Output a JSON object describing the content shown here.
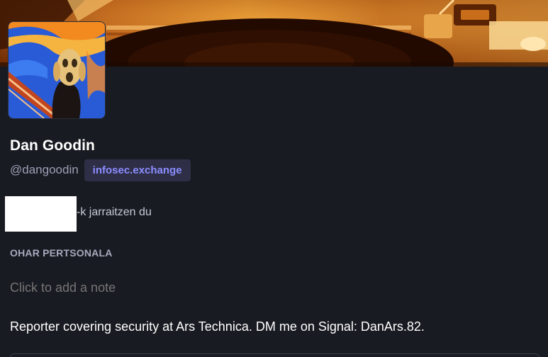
{
  "profile": {
    "display_name": "Dan Goodin",
    "username": "@dangoodin",
    "domain": "infosec.exchange",
    "follows_you_text": "-k jarraitzen du",
    "bio": "Reporter covering security at Ars Technica. DM me on Signal: DanArs.82."
  },
  "note": {
    "label": "OHAR PERTSONALA",
    "placeholder": "Click to add a note"
  },
  "icons": {
    "header_image": "record-player-header-image",
    "avatar": "the-scream-avatar"
  },
  "colors": {
    "background": "#191b22",
    "accent": "#8c8dff",
    "badge_background": "#2e2f47",
    "muted_text": "#9ba0b5"
  }
}
